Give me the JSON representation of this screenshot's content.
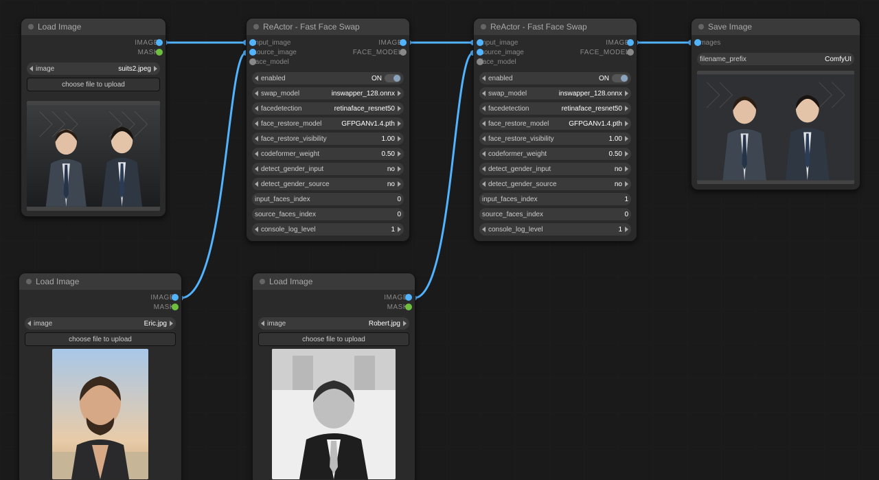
{
  "io_labels": {
    "IMAGE": "IMAGE",
    "MASK": "MASK",
    "FACE_MODEL": "FACE_MODEL",
    "input_image": "input_image",
    "source_image": "source_image",
    "face_model": "face_model",
    "images": "images"
  },
  "common": {
    "choose_file": "choose file to upload",
    "image_label": "image"
  },
  "nodes": {
    "loadA": {
      "title": "Load Image",
      "file": "suits2.jpeg"
    },
    "loadB": {
      "title": "Load Image",
      "file": "Eric.jpg"
    },
    "loadC": {
      "title": "Load Image",
      "file": "Robert.jpg"
    },
    "save": {
      "title": "Save Image",
      "prefix_label": "filename_prefix",
      "prefix_value": "ComfyUI"
    },
    "reactor1": {
      "title": "ReActor - Fast Face Swap",
      "params": [
        {
          "k": "enabled",
          "v": "ON",
          "toggle": true
        },
        {
          "k": "swap_model",
          "v": "inswapper_128.onnx"
        },
        {
          "k": "facedetection",
          "v": "retinaface_resnet50"
        },
        {
          "k": "face_restore_model",
          "v": "GFPGANv1.4.pth"
        },
        {
          "k": "face_restore_visibility",
          "v": "1.00"
        },
        {
          "k": "codeformer_weight",
          "v": "0.50"
        },
        {
          "k": "detect_gender_input",
          "v": "no"
        },
        {
          "k": "detect_gender_source",
          "v": "no"
        },
        {
          "k": "input_faces_index",
          "v": "0",
          "plain": true
        },
        {
          "k": "source_faces_index",
          "v": "0",
          "plain": true
        },
        {
          "k": "console_log_level",
          "v": "1"
        }
      ]
    },
    "reactor2": {
      "title": "ReActor - Fast Face Swap",
      "params": [
        {
          "k": "enabled",
          "v": "ON",
          "toggle": true
        },
        {
          "k": "swap_model",
          "v": "inswapper_128.onnx"
        },
        {
          "k": "facedetection",
          "v": "retinaface_resnet50"
        },
        {
          "k": "face_restore_model",
          "v": "GFPGANv1.4.pth"
        },
        {
          "k": "face_restore_visibility",
          "v": "1.00"
        },
        {
          "k": "codeformer_weight",
          "v": "0.50"
        },
        {
          "k": "detect_gender_input",
          "v": "no"
        },
        {
          "k": "detect_gender_source",
          "v": "no"
        },
        {
          "k": "input_faces_index",
          "v": "1",
          "plain": true
        },
        {
          "k": "source_faces_index",
          "v": "0",
          "plain": true
        },
        {
          "k": "console_log_level",
          "v": "1"
        }
      ]
    }
  }
}
